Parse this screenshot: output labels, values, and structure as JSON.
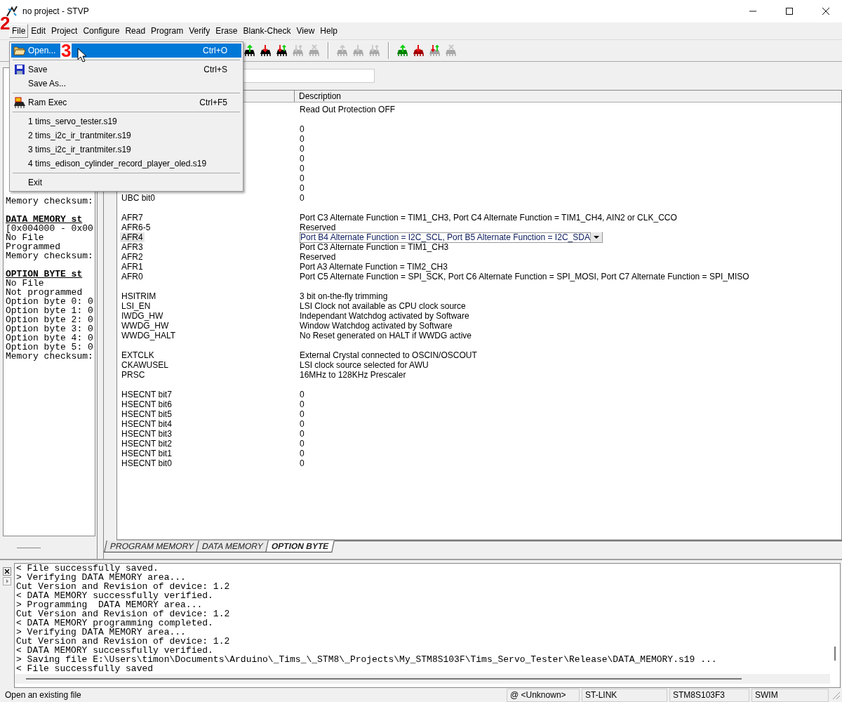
{
  "window": {
    "title": "no project - STVP"
  },
  "annotations": [
    "2",
    "3"
  ],
  "menu_bar": [
    {
      "label": "File",
      "selected": true
    },
    {
      "label": "Edit",
      "selected": false
    },
    {
      "label": "Project",
      "selected": false
    },
    {
      "label": "Configure",
      "selected": false
    },
    {
      "label": "Read",
      "selected": false
    },
    {
      "label": "Program",
      "selected": false
    },
    {
      "label": "Verify",
      "selected": false
    },
    {
      "label": "Erase",
      "selected": false
    },
    {
      "label": "Blank-Check",
      "selected": false
    },
    {
      "label": "View",
      "selected": false
    },
    {
      "label": "Help",
      "selected": false
    }
  ],
  "file_menu": [
    {
      "kind": "item",
      "label": "Open...",
      "shortcut": "Ctrl+O",
      "selected": true
    },
    {
      "kind": "separator"
    },
    {
      "kind": "item",
      "label": "Save",
      "shortcut": "Ctrl+S",
      "selected": false
    },
    {
      "kind": "item",
      "label": "Save As...",
      "selected": false
    },
    {
      "kind": "separator"
    },
    {
      "kind": "item",
      "label": "Ram Exec",
      "shortcut": "Ctrl+F5",
      "selected": false
    },
    {
      "kind": "separator"
    },
    {
      "kind": "item",
      "label": "1 tims_servo_tester.s19",
      "selected": false
    },
    {
      "kind": "item",
      "label": "2 tims_i2c_ir_trantmiter.s19",
      "selected": false
    },
    {
      "kind": "item",
      "label": "3 tims_i2c_ir_trantmiter.s19",
      "selected": false
    },
    {
      "kind": "item",
      "label": "4 tims_edison_cylinder_record_player_oled.s19",
      "selected": false
    },
    {
      "kind": "separator"
    },
    {
      "kind": "item",
      "label": "Exit",
      "selected": false
    }
  ],
  "toolbar": [
    {
      "kind": "up",
      "color": "#000000",
      "disabled": false
    },
    {
      "kind": "down",
      "color": "#000000",
      "disabled": false
    },
    {
      "kind": "both",
      "color": "#000000",
      "disabled": false
    },
    {
      "kind": "both",
      "color": "#a8a8a8",
      "disabled": true
    },
    {
      "kind": "cross",
      "color": "#a8a8a8",
      "disabled": true
    },
    {
      "kind": "separator"
    },
    {
      "kind": "up",
      "color": "#a8a8a8",
      "disabled": true
    },
    {
      "kind": "down",
      "color": "#a8a8a8",
      "disabled": true
    },
    {
      "kind": "both",
      "color": "#a8a8a8",
      "disabled": true
    },
    {
      "kind": "separator"
    },
    {
      "kind": "up",
      "color": "#008000",
      "disabled": false
    },
    {
      "kind": "down",
      "color": "#a00000",
      "disabled": false
    },
    {
      "kind": "both",
      "color": "#a0a0a0",
      "disabled": false
    },
    {
      "kind": "cross",
      "color": "#a8a8a8",
      "disabled": true
    }
  ],
  "left_panel": [
    {
      "kind": "blank"
    },
    {
      "kind": "blank"
    },
    {
      "kind": "blank"
    },
    {
      "kind": "blank"
    },
    {
      "kind": "blank"
    },
    {
      "kind": "blank"
    },
    {
      "kind": "blank"
    },
    {
      "kind": "blank"
    },
    {
      "kind": "blank"
    },
    {
      "kind": "blank"
    },
    {
      "kind": "blank"
    },
    {
      "kind": "blank"
    },
    {
      "kind": "blank"
    },
    {
      "kind": "text",
      "text": "Memory checksum:"
    },
    {
      "kind": "blank"
    },
    {
      "kind": "heading",
      "text": "DATA MEMORY st"
    },
    {
      "kind": "text",
      "text": "[0x004000 - 0x00"
    },
    {
      "kind": "text",
      "text": "No File"
    },
    {
      "kind": "text",
      "text": "Programmed"
    },
    {
      "kind": "text",
      "text": "Memory checksum:"
    },
    {
      "kind": "blank"
    },
    {
      "kind": "heading",
      "text": "OPTION BYTE st"
    },
    {
      "kind": "text",
      "text": "No File"
    },
    {
      "kind": "text",
      "text": "Not programmed"
    },
    {
      "kind": "text",
      "text": "Option byte 0: 0"
    },
    {
      "kind": "text",
      "text": "Option byte 1: 0"
    },
    {
      "kind": "text",
      "text": "Option byte 2: 0"
    },
    {
      "kind": "text",
      "text": "Option byte 3: 0"
    },
    {
      "kind": "text",
      "text": "Option byte 4: 0"
    },
    {
      "kind": "text",
      "text": "Option byte 5: 0"
    },
    {
      "kind": "text",
      "text": "Memory checksum:"
    }
  ],
  "table": {
    "columns": [
      "Description"
    ],
    "rows": [
      {
        "kind": "row",
        "description": "Read Out Protection OFF",
        "selected": false
      },
      {
        "kind": "spacer"
      },
      {
        "kind": "row",
        "description": "0",
        "selected": false
      },
      {
        "kind": "row",
        "description": "0",
        "selected": false
      },
      {
        "kind": "row",
        "description": "0",
        "selected": false
      },
      {
        "kind": "row",
        "description": "0",
        "selected": false
      },
      {
        "kind": "row",
        "description": "0",
        "selected": false
      },
      {
        "kind": "row",
        "description": "0",
        "selected": false
      },
      {
        "kind": "row",
        "description": "0",
        "selected": false
      },
      {
        "kind": "row",
        "name": "UBC bit0",
        "description": "0",
        "selected": false
      },
      {
        "kind": "spacer"
      },
      {
        "kind": "row",
        "name": "AFR7",
        "description": "Port C3 Alternate Function = TIM1_CH3, Port C4 Alternate Function = TIM1_CH4, AIN2 or CLK_CCO",
        "selected": false
      },
      {
        "kind": "row",
        "name": "AFR6-5",
        "description": "Reserved",
        "selected": false
      },
      {
        "kind": "row",
        "name": "AFR4",
        "description": "Port B4 Alternate Function = I2C_SCL, Port B5 Alternate Function = I2C_SDA",
        "selected": true
      },
      {
        "kind": "row",
        "name": "AFR3",
        "description": "Port C3 Alternate Function = TIM1_CH3",
        "selected": false
      },
      {
        "kind": "row",
        "name": "AFR2",
        "description": "Reserved",
        "selected": false
      },
      {
        "kind": "row",
        "name": "AFR1",
        "description": "Port A3 Alternate Function = TIM2_CH3",
        "selected": false
      },
      {
        "kind": "row",
        "name": "AFR0",
        "description": "Port C5 Alternate Function = SPI_SCK, Port C6 Alternate Function = SPI_MOSI, Port C7 Alternate Function = SPI_MISO",
        "selected": false
      },
      {
        "kind": "spacer"
      },
      {
        "kind": "row",
        "name": "HSITRIM",
        "description": "3 bit on-the-fly trimming",
        "selected": false
      },
      {
        "kind": "row",
        "name": "LSI_EN",
        "description": "LSI Clock not available as CPU clock source",
        "selected": false
      },
      {
        "kind": "row",
        "name": "IWDG_HW",
        "description": "Independant Watchdog activated by Software",
        "selected": false
      },
      {
        "kind": "row",
        "name": "WWDG_HW",
        "description": "Window Watchdog activated by Software",
        "selected": false
      },
      {
        "kind": "row",
        "name": "WWDG_HALT",
        "description": "No Reset generated on HALT if WWDG active",
        "selected": false
      },
      {
        "kind": "spacer"
      },
      {
        "kind": "row",
        "name": "EXTCLK",
        "description": "External Crystal connected to OSCIN/OSCOUT",
        "selected": false
      },
      {
        "kind": "row",
        "name": "CKAWUSEL",
        "description": "LSI clock source selected for AWU",
        "selected": false
      },
      {
        "kind": "row",
        "name": "PRSC",
        "description": "16MHz to 128KHz Prescaler",
        "selected": false
      },
      {
        "kind": "spacer"
      },
      {
        "kind": "row",
        "name": "HSECNT bit7",
        "description": "0",
        "selected": false
      },
      {
        "kind": "row",
        "name": "HSECNT bit6",
        "description": "0",
        "selected": false
      },
      {
        "kind": "row",
        "name": "HSECNT bit5",
        "description": "0",
        "selected": false
      },
      {
        "kind": "row",
        "name": "HSECNT bit4",
        "description": "0",
        "selected": false
      },
      {
        "kind": "row",
        "name": "HSECNT bit3",
        "description": "0",
        "selected": false
      },
      {
        "kind": "row",
        "name": "HSECNT bit2",
        "description": "0",
        "selected": false
      },
      {
        "kind": "row",
        "name": "HSECNT bit1",
        "description": "0",
        "selected": false
      },
      {
        "kind": "row",
        "name": "HSECNT bit0",
        "description": "0",
        "selected": false
      }
    ]
  },
  "tabs": [
    {
      "label": "PROGRAM MEMORY",
      "selected": false
    },
    {
      "label": "DATA MEMORY",
      "selected": false
    },
    {
      "label": "OPTION BYTE",
      "selected": true
    }
  ],
  "log": [
    "< File successfully saved.",
    "> Verifying DATA MEMORY area...",
    "Cut Version and Revision of device: 1.2",
    "< DATA MEMORY successfully verified.",
    "> Programming  DATA MEMORY area...",
    "Cut Version and Revision of device: 1.2",
    "< DATA MEMORY programming completed.",
    "> Verifying DATA MEMORY area...",
    "Cut Version and Revision of device: 1.2",
    "< DATA MEMORY successfully verified.",
    "> Saving file E:\\Users\\timon\\Documents\\Arduino\\_Tims_\\_STM8\\_Projects\\My_STM8S103F\\Tims_Servo_Tester\\Release\\DATA_MEMORY.s19 ...",
    "< File successfully saved"
  ],
  "status_bar": [
    "Open an existing file",
    "@ <Unknown>",
    "ST-LINK",
    "STM8S103F3",
    "SWIM"
  ]
}
